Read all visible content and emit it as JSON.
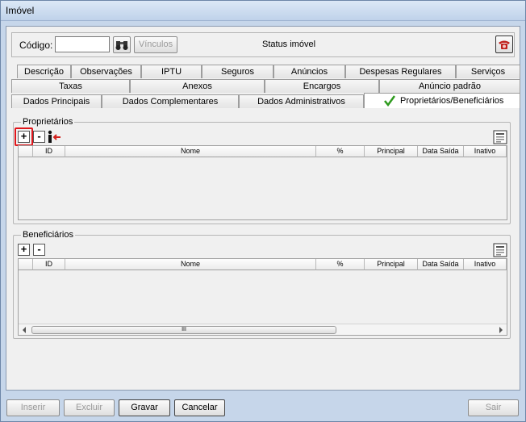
{
  "window": {
    "title": "Imóvel"
  },
  "header": {
    "codigo_label": "Código:",
    "codigo_value": "",
    "vinculos_label": "Vínculos",
    "status_label": "Status imóvel",
    "icons": {
      "search": "binoculars-icon",
      "phone": "telephone-icon"
    }
  },
  "tabs": {
    "row1": [
      "Descrição",
      "Observações",
      "IPTU",
      "Seguros",
      "Anúncios",
      "Despesas Regulares",
      "Serviços"
    ],
    "row2": [
      "Taxas",
      "Anexos",
      "Encargos",
      "Anúncio padrão"
    ],
    "row3": [
      "Dados Principais",
      "Dados Complementares",
      "Dados Administrativos",
      "Proprietários/Beneficiários"
    ],
    "active": "Proprietários/Beneficiários"
  },
  "proprietarios": {
    "title": "Proprietários",
    "add_label": "+",
    "remove_label": "-",
    "columns": [
      "ID",
      "Nome",
      "%",
      "Principal",
      "Data Saída",
      "Inativo"
    ],
    "rows": []
  },
  "beneficiarios": {
    "title": "Beneficiários",
    "add_label": "+",
    "remove_label": "-",
    "columns": [
      "ID",
      "Nome",
      "%",
      "Principal",
      "Data Saída",
      "Inativo"
    ],
    "rows": [],
    "scroll_thumb": "III"
  },
  "footer": {
    "inserir": "Inserir",
    "excluir": "Excluir",
    "gravar": "Gravar",
    "cancelar": "Cancelar",
    "sair": "Sair"
  },
  "colors": {
    "highlight": "#e0161b",
    "check": "#2e9a1e",
    "titlebar": "#c6d6ea"
  }
}
